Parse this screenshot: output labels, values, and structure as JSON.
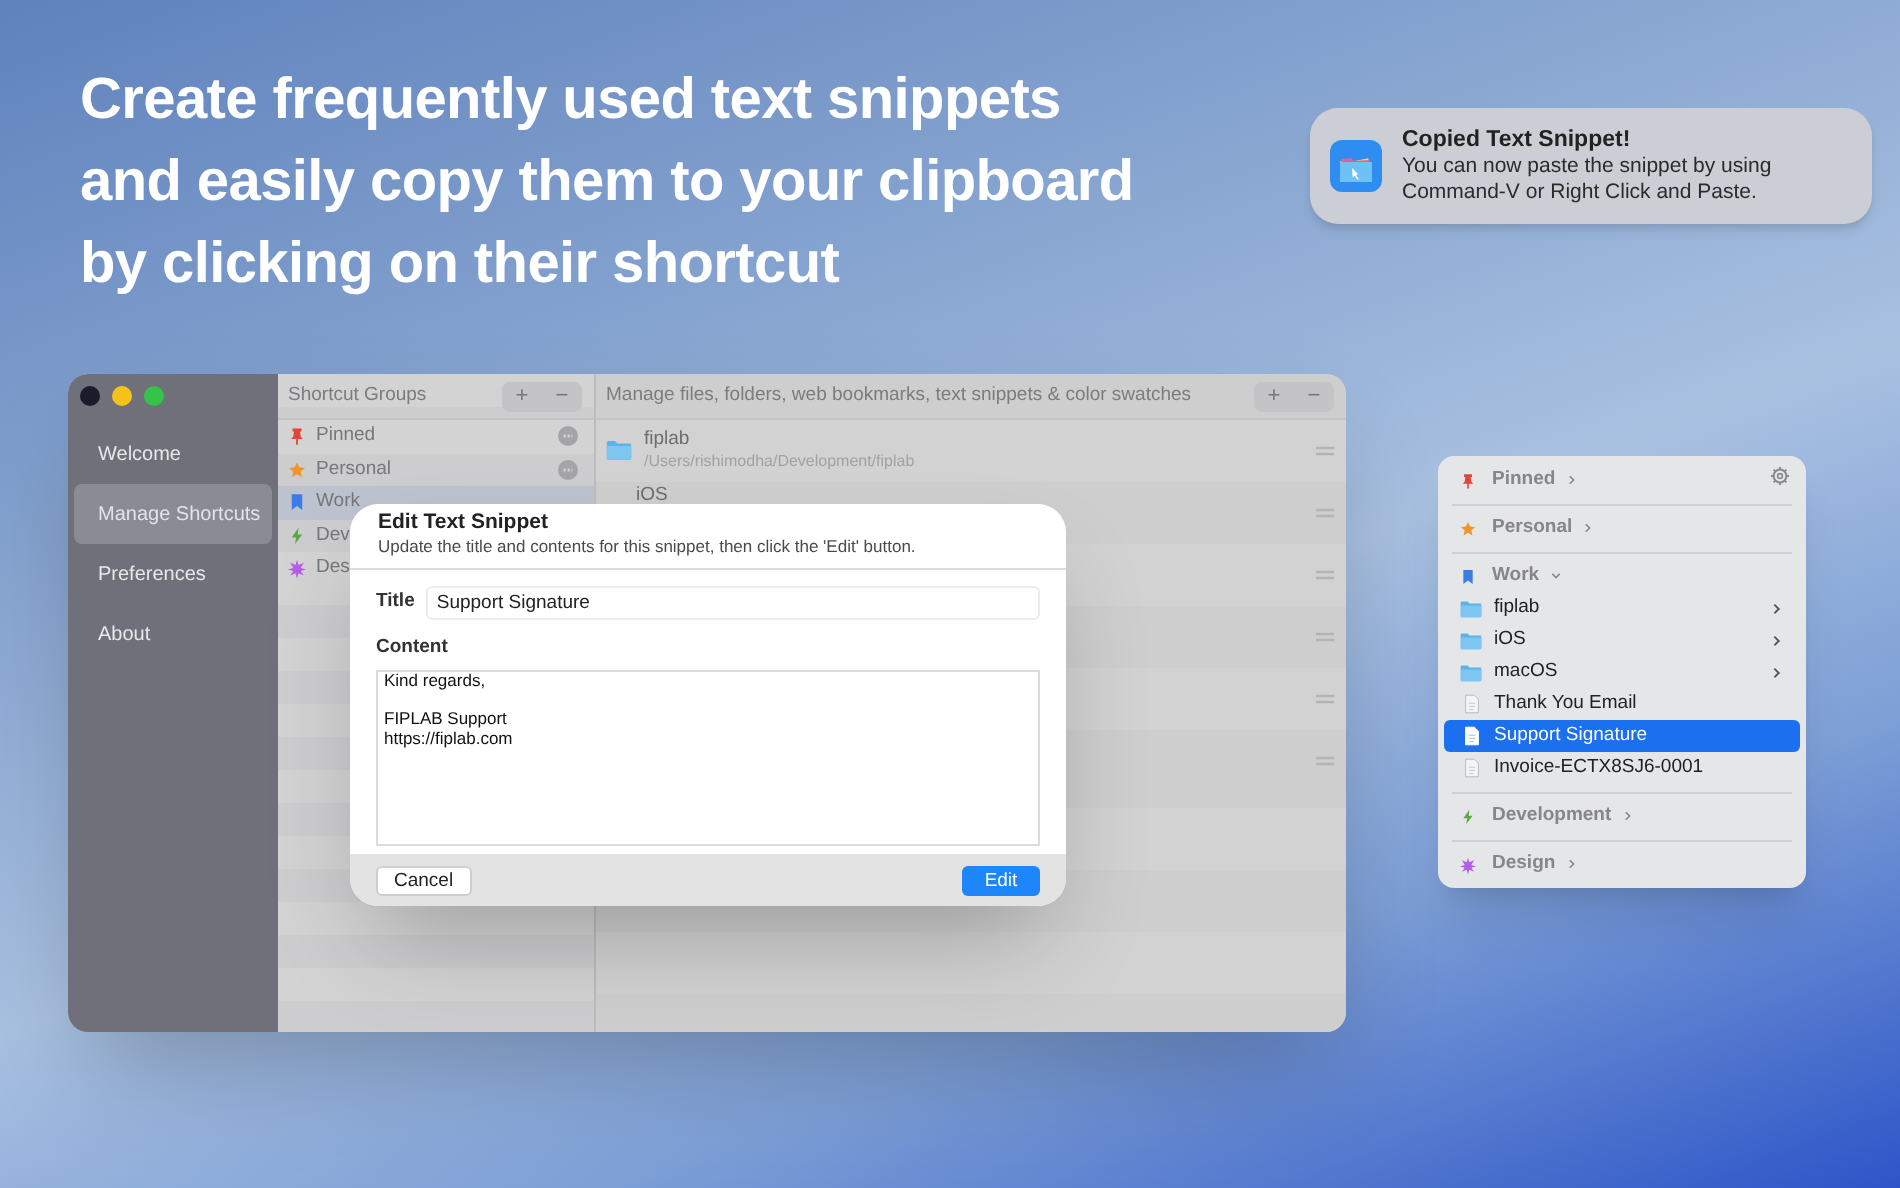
{
  "headline": {
    "lines": [
      "Create frequently used text snippets",
      "and easily copy them to your clipboard",
      "by clicking on their shortcut"
    ]
  },
  "notification": {
    "title": "Copied Text Snippet!",
    "body_lines": [
      "You can now paste the snippet by using",
      "Command-V or Right Click and Paste."
    ]
  },
  "window": {
    "sidebar": {
      "items": [
        {
          "label": "Welcome",
          "selected": false
        },
        {
          "label": "Manage Shortcuts",
          "selected": true
        },
        {
          "label": "Preferences",
          "selected": false
        },
        {
          "label": "About",
          "selected": false
        }
      ]
    },
    "groups": {
      "header": "Shortcut Groups",
      "buttons": [
        "+",
        "−"
      ],
      "items": [
        {
          "label": "Pinned",
          "kind": "pin",
          "color": "#e0443a",
          "selected": false
        },
        {
          "label": "Personal",
          "kind": "star",
          "color": "#f0952c",
          "selected": false
        },
        {
          "label": "Work",
          "kind": "bookmark",
          "color": "#3b7ce8",
          "selected": true
        },
        {
          "label": "Dev",
          "kind": "bolt",
          "color": "#5aa845",
          "selected": false
        },
        {
          "label": "Des",
          "kind": "sparkle",
          "color": "#b45ee8",
          "selected": false
        }
      ]
    },
    "shortcuts": {
      "header": "Manage files, folders, web bookmarks, text snippets & color swatches",
      "buttons": [
        "+",
        "−"
      ],
      "rows": [
        {
          "title": "fiplab",
          "subtitle": "/Users/rishimodha/Development/fiplab",
          "kind": "folder"
        },
        {
          "title": "iOS",
          "kind": "none"
        }
      ]
    }
  },
  "dialog": {
    "title": "Edit Text Snippet",
    "subtitle": "Update the title and contents for this snippet, then click the 'Edit' button.",
    "title_label": "Title",
    "title_value": "Support Signature",
    "content_label": "Content",
    "content_value": "Kind regards,\n\nFIPLAB Support\nhttps://fiplab.com",
    "cancel": "Cancel",
    "confirm": "Edit"
  },
  "menu": {
    "sections": [
      {
        "label": "Pinned",
        "kind": "pin",
        "color": "#e0443a",
        "expanded": false
      },
      {
        "label": "Personal",
        "kind": "star",
        "color": "#f0952c",
        "expanded": false
      },
      {
        "label": "Work",
        "kind": "bookmark",
        "color": "#3b7ce8",
        "expanded": true,
        "items": [
          {
            "label": "fiplab",
            "kind": "folder",
            "submenu": true,
            "selected": false
          },
          {
            "label": "iOS",
            "kind": "folder",
            "submenu": true,
            "selected": false
          },
          {
            "label": "macOS",
            "kind": "folder",
            "submenu": true,
            "selected": false
          },
          {
            "label": "Thank You Email",
            "kind": "file",
            "submenu": false,
            "selected": false
          },
          {
            "label": "Support Signature",
            "kind": "file",
            "submenu": false,
            "selected": true
          },
          {
            "label": "Invoice-ECTX8SJ6-0001",
            "kind": "file",
            "submenu": false,
            "selected": false
          }
        ]
      },
      {
        "label": "Development",
        "kind": "bolt",
        "color": "#5aa845",
        "expanded": false
      },
      {
        "label": "Design",
        "kind": "sparkle",
        "color": "#b45ee8",
        "expanded": false
      }
    ]
  }
}
